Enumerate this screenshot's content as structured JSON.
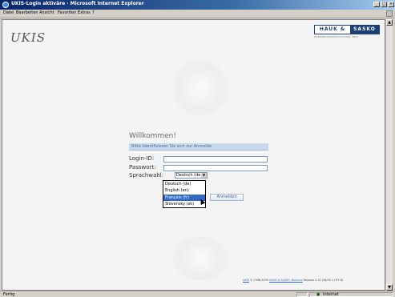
{
  "window": {
    "title": "UKIS-Login aktiväre · Microsoft Internet Explorer",
    "minimize_label": "_",
    "maximize_label": "□",
    "close_label": "×"
  },
  "menubar": {
    "items": [
      "Datei",
      "Bearbeiten",
      "Ansicht",
      "Favoriten",
      "Extras",
      "?"
    ]
  },
  "page": {
    "logo_text": "UKIS",
    "partner_logo_left": "HAUK &",
    "partner_logo_right": "SASKO",
    "partner_tagline": "INGENIEURGESELLSCHAFT MBH",
    "welcome": "Willkommen!",
    "hint": "Bitte identifizieren Sie sich zur Anmelde",
    "login_label": "Login-ID:",
    "password_label": "Passwort:",
    "language_label": "Sprachwahl:",
    "language_selected": "Deutsch (de)",
    "language_options": [
      "Deutsch (de)",
      "English (en)",
      "Français (fr)",
      "Slovensky (sk)"
    ],
    "language_highlighted_index": 2,
    "login_button": "Anmelden",
    "footer_prefix": "",
    "footer_link1": "UKIS",
    "footer_mid": "© 1998-2009",
    "footer_link2": "HAUK & SASKO, Bochum",
    "footer_suffix": "Release 5.10 (04/05.1 UTF-8)"
  },
  "statusbar": {
    "left": "Fertig",
    "zone": "Internet"
  },
  "icons": {
    "dropdown": "chevron-down-icon",
    "ie": "internet-explorer-icon"
  },
  "colors": {
    "titlebar": "#0a246a",
    "brand": "#1c3f77",
    "highlight": "#316ac5"
  }
}
